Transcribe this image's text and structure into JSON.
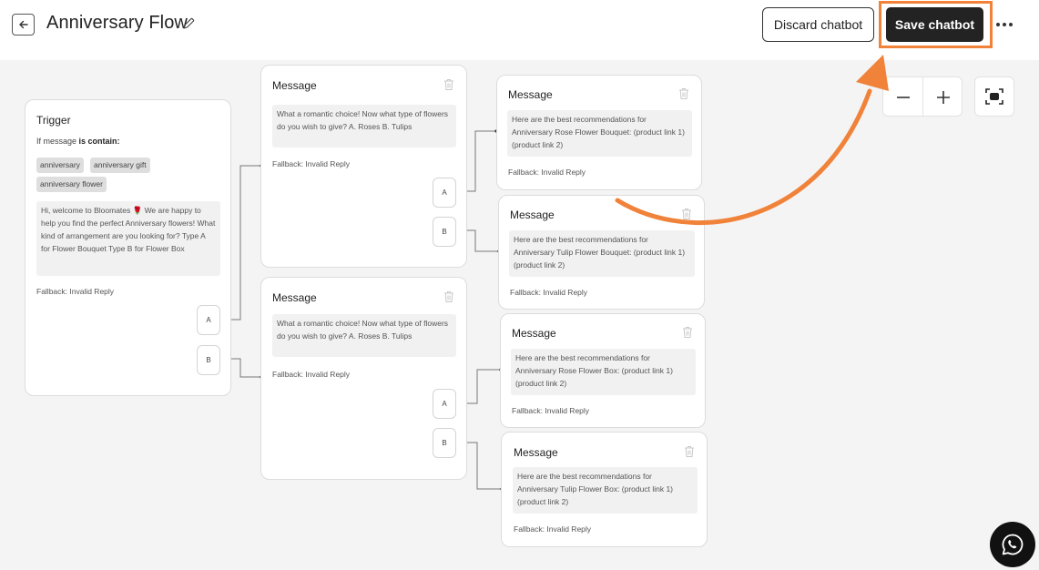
{
  "header": {
    "title": "Anniversary Flow",
    "discard_label": "Discard chatbot",
    "save_label": "Save chatbot"
  },
  "trigger": {
    "title": "Trigger",
    "condition_prefix": "If message",
    "condition_bold": "is contain:",
    "keywords": [
      "anniversary",
      "anniversary gift",
      "anniversary flower"
    ],
    "message": "Hi, welcome to Bloomates 🌹 We are happy to help you find the perfect Anniversary flowers! What kind of arrangement are you looking for? Type A for Flower Bouquet Type B for Flower Box",
    "fallback": "Fallback: Invalid Reply",
    "options": [
      "A",
      "B"
    ]
  },
  "messages": [
    {
      "title": "Message",
      "text": "What a romantic choice! Now what type of flowers do you wish to give? A. Roses B. Tulips",
      "fallback": "Fallback: Invalid Reply",
      "options": [
        "A",
        "B"
      ]
    },
    {
      "title": "Message",
      "text": "What a romantic choice! Now what type of flowers do you wish to give? A. Roses B. Tulips",
      "fallback": "Fallback: Invalid Reply",
      "options": [
        "A",
        "B"
      ]
    },
    {
      "title": "Message",
      "text": "Here are the best recommendations for Anniversary Rose Flower Bouquet: (product link 1) (product link 2)",
      "fallback": "Fallback: Invalid Reply"
    },
    {
      "title": "Message",
      "text": "Here are the best recommendations for Anniversary Tulip Flower Bouquet: (product link 1) (product link 2)",
      "fallback": "Fallback: Invalid Reply"
    },
    {
      "title": "Message",
      "text": "Here are the best recommendations for Anniversary Rose Flower Box: (product link 1) (product link 2)",
      "fallback": "Fallback: Invalid Reply"
    },
    {
      "title": "Message",
      "text": "Here are the best recommendations for Anniversary Tulip Flower Box: (product link 1) (product link 2)",
      "fallback": "Fallback: Invalid Reply"
    }
  ],
  "icons": {
    "back": "arrow-left-icon",
    "edit": "pencil-icon",
    "more": "more-horizontal-icon",
    "delete": "trash-icon",
    "zoom_out": "minus-icon",
    "zoom_in": "plus-icon",
    "fit": "fit-screen-icon",
    "whatsapp": "whatsapp-icon"
  },
  "colors": {
    "accent": "#f0823a",
    "primary_button": "#232323",
    "canvas": "#f4f4f4"
  }
}
